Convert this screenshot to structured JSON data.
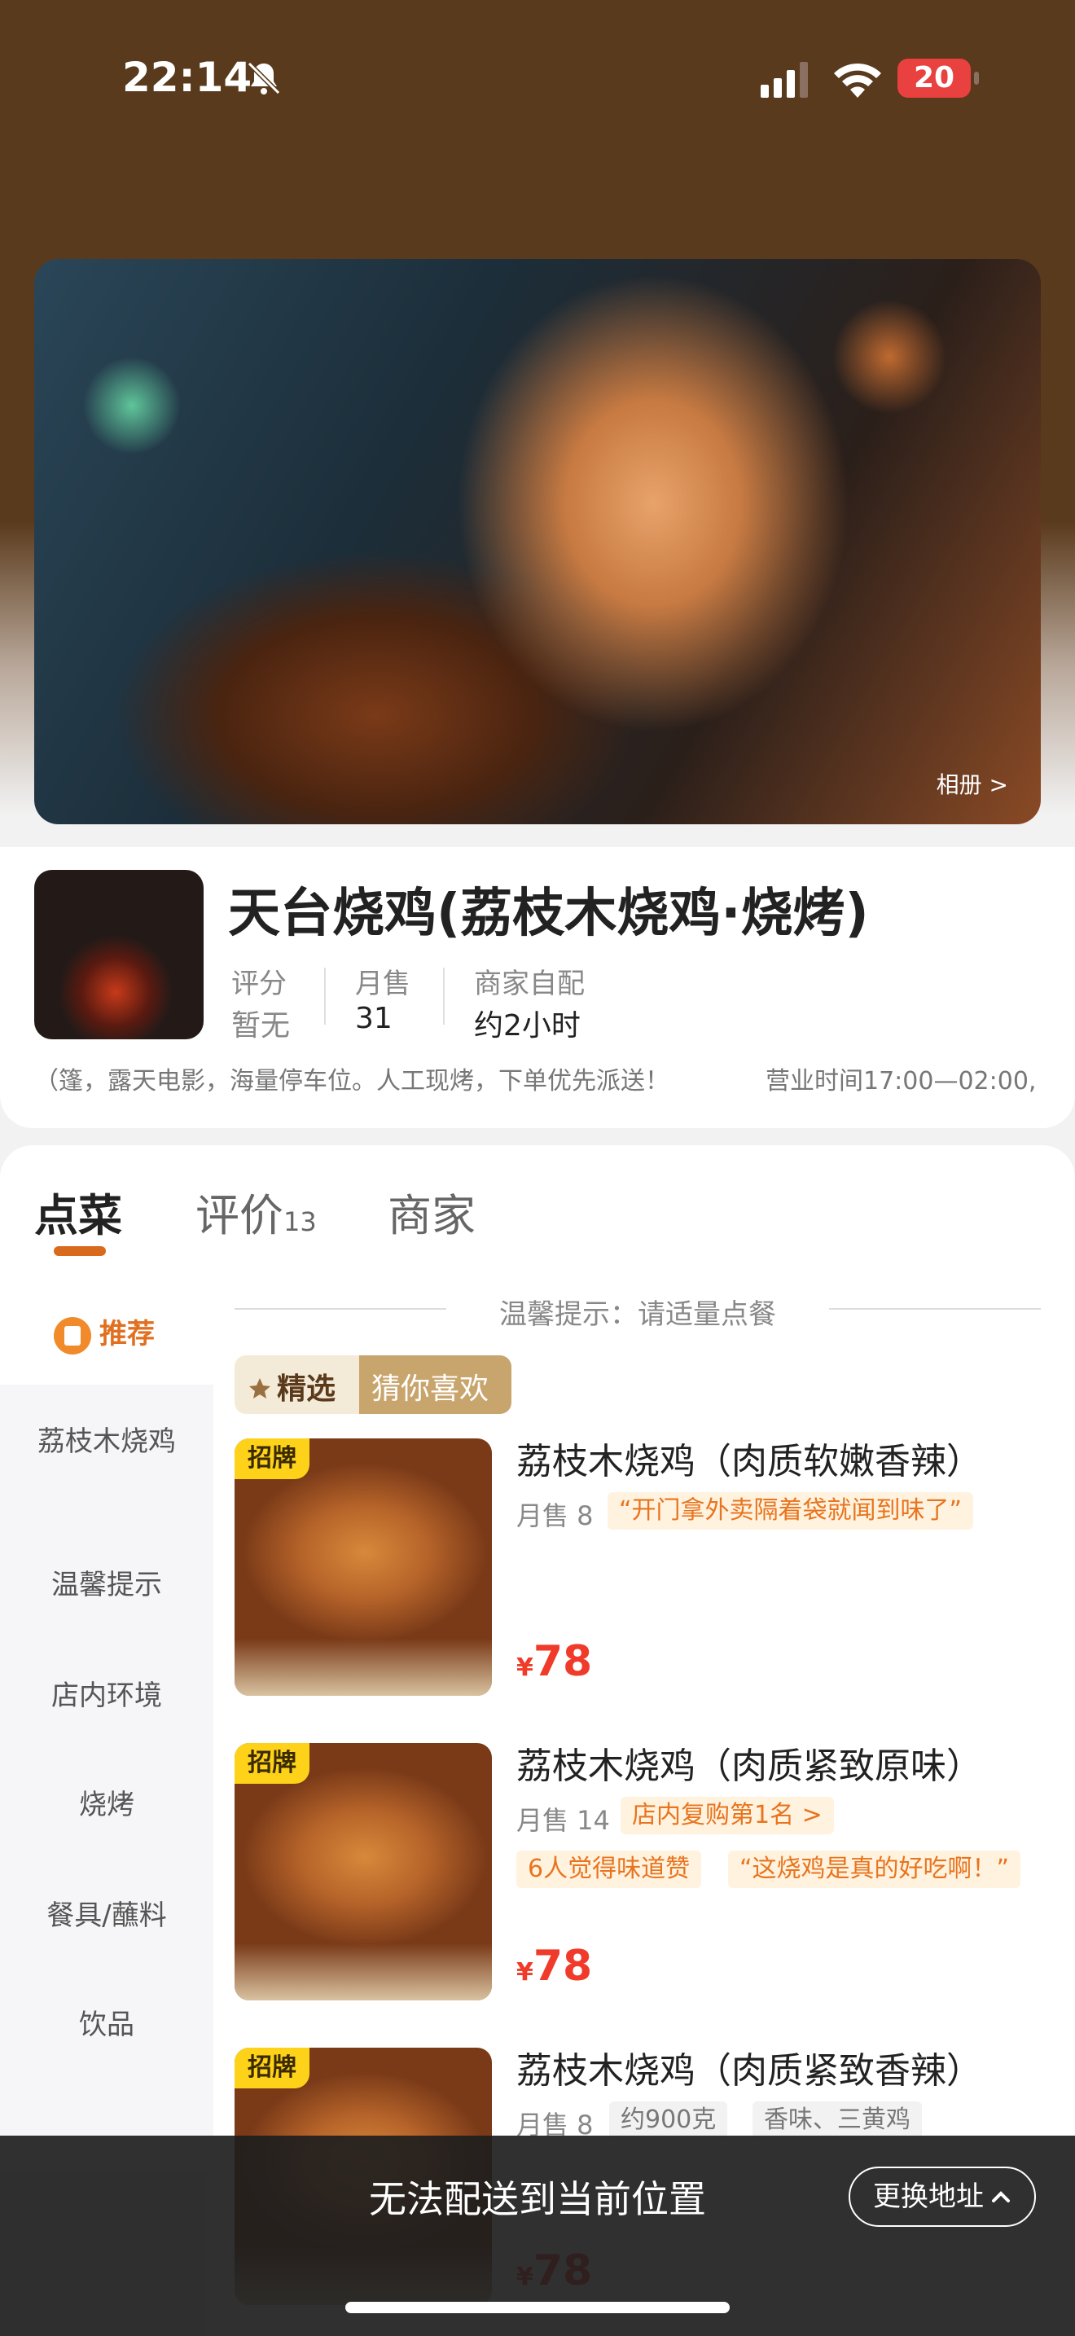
{
  "status": {
    "time": "22:14",
    "battery": "20"
  },
  "hero": {
    "album_link": "相册 >"
  },
  "shop": {
    "name": "天台烧鸡(荔枝木烧鸡·烧烤)",
    "stats": [
      {
        "label": "评分",
        "value": "暂无"
      },
      {
        "label": "月售",
        "value": "31"
      },
      {
        "label": "商家自配",
        "value": "约2小时"
      }
    ],
    "notice": "（篷，露天电影，海量停车位。人工现烤，下单优先派送！",
    "hours": "营业时间17:00—02:00,"
  },
  "tabs": [
    {
      "label": "点菜",
      "count": ""
    },
    {
      "label": "评价",
      "count": "13"
    },
    {
      "label": "商家",
      "count": ""
    }
  ],
  "sidebar": {
    "active": "推荐",
    "items": [
      "荔枝木烧鸡",
      "温馨提示",
      "店内环境",
      "烧烤",
      "餐具/蘸料",
      "饮品"
    ]
  },
  "hint": "温馨提示：请适量点餐",
  "section_tags": {
    "a": "精选",
    "b": "猜你喜欢"
  },
  "dishes": [
    {
      "badge": "招牌",
      "name": "荔枝木烧鸡（肉质软嫩香辣）",
      "sold": "月售 8",
      "chips": [
        "“开门拿外卖隔着袋就闻到味了”"
      ],
      "chips2": [],
      "currency": "¥",
      "price": "78"
    },
    {
      "badge": "招牌",
      "name": "荔枝木烧鸡（肉质紧致原味）",
      "sold": "月售 14",
      "chips": [
        "店内复购第1名 >"
      ],
      "chips2": [
        "6人觉得味道赞",
        "“这烧鸡是真的好吃啊！”"
      ],
      "currency": "¥",
      "price": "78"
    },
    {
      "badge": "招牌",
      "name": "荔枝木烧鸡（肉质紧致香辣）",
      "sold": "月售 8",
      "chips": [
        "约900克",
        "香味、三黄鸡"
      ],
      "chips2": [],
      "currency": "¥",
      "price": "78"
    }
  ],
  "bottom": {
    "message": "无法配送到当前位置",
    "button": "更换地址"
  },
  "colors": {
    "brand_brown": "#5a3a1c",
    "accent_orange": "#e8741e",
    "price_red": "#f03a2a",
    "badge_yellow": "#ffd21a"
  }
}
